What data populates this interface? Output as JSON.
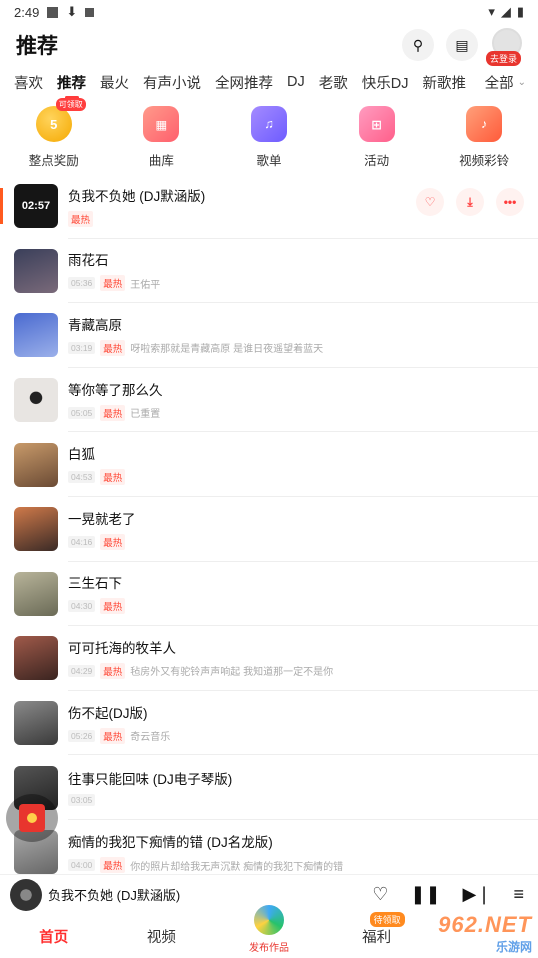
{
  "status": {
    "time": "2:49"
  },
  "header": {
    "title": "推荐",
    "login_label": "去登录"
  },
  "tabs": [
    "喜欢",
    "推荐",
    "最火",
    "有声小说",
    "全网推荐",
    "DJ",
    "老歌",
    "快乐DJ",
    "新歌推"
  ],
  "tabs_all_label": "全部",
  "quick": [
    {
      "label": "整点奖励",
      "coin_value": "5",
      "badge": "可领取",
      "color": "#f5a800"
    },
    {
      "label": "曲库",
      "color": "#ff6b6b"
    },
    {
      "label": "歌单",
      "color": "#7b6cff"
    },
    {
      "label": "活动",
      "color": "#ff5f8a"
    },
    {
      "label": "视频彩铃",
      "color": "#ff5a3a"
    }
  ],
  "songs": [
    {
      "title": "负我不负她 (DJ默涵版)",
      "duration": "02:57",
      "hot": "最热",
      "artist": "",
      "cover": "#1a1a1a",
      "cover_text": "02:57"
    },
    {
      "title": "雨花石",
      "duration": "05:36",
      "hot": "最热",
      "artist": "王佑平",
      "cover": "#5a5468"
    },
    {
      "title": "青藏高原",
      "duration": "03:19",
      "hot": "最热",
      "artist": "呀啦索那就是青藏高原 是谁日夜遥望着蓝天",
      "cover": "#6b7dc2"
    },
    {
      "title": "等你等了那么久",
      "duration": "05:05",
      "hot": "最热",
      "artist": "已重置",
      "cover": "#d6d3d0"
    },
    {
      "title": "白狐",
      "duration": "04:53",
      "hot": "最热",
      "artist": "",
      "cover": "#9a7a5a"
    },
    {
      "title": "一晃就老了",
      "duration": "04:16",
      "hot": "最热",
      "artist": "",
      "cover": "#6b4a3a"
    },
    {
      "title": "三生石下",
      "duration": "04:30",
      "hot": "最热",
      "artist": "",
      "cover": "#8a8a70"
    },
    {
      "title": "可可托海的牧羊人",
      "duration": "04:29",
      "hot": "最热",
      "artist": "毡房外又有驼铃声声响起 我知道那一定不是你",
      "cover": "#7a4a3e"
    },
    {
      "title": "伤不起(DJ版)",
      "duration": "05:26",
      "hot": "最热",
      "artist": "奇云音乐",
      "cover": "#5e5e5e"
    },
    {
      "title": "往事只能回味 (DJ电子琴版)",
      "duration": "03:05",
      "hot": "",
      "artist": "",
      "cover": "#3a3a3a"
    },
    {
      "title": "痴情的我犯下痴情的错 (DJ名龙版)",
      "duration": "04:00",
      "hot": "最热",
      "artist": "你的照片却给我无声沉默 痴情的我犯下痴情的错",
      "cover": "#8a8a8a"
    }
  ],
  "player": {
    "title": "负我不负她 (DJ默涵版)"
  },
  "nav": {
    "home": "首页",
    "video": "视频",
    "publish": "发布作品",
    "welfare": "福利",
    "pending": "待领取"
  },
  "watermark": {
    "big": "962.NET",
    "small": "乐游网"
  }
}
